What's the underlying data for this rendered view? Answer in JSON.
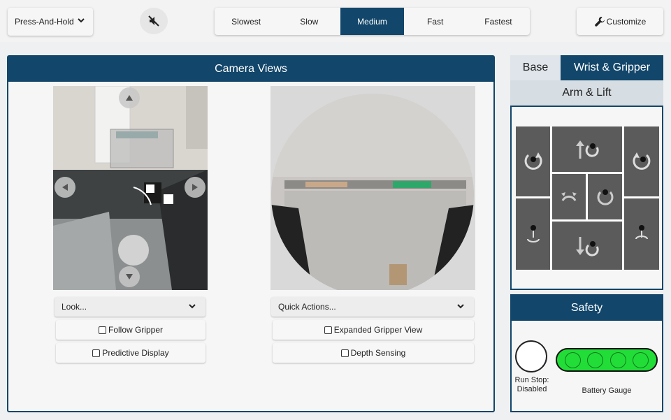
{
  "topbar": {
    "mode_select": "Press-And-Hold",
    "mute_icon": "speaker-muted-icon",
    "speeds": [
      "Slowest",
      "Slow",
      "Medium",
      "Fast",
      "Fastest"
    ],
    "active_speed": "Medium",
    "customize_label": "Customize",
    "customize_icon": "wrench-icon"
  },
  "camera_panel": {
    "title": "Camera Views",
    "left": {
      "dropdown": "Look...",
      "checks": [
        "Follow Gripper",
        "Predictive Display"
      ]
    },
    "right": {
      "dropdown": "Quick Actions...",
      "checks": [
        "Expanded Gripper View",
        "Depth Sensing"
      ]
    }
  },
  "controls": {
    "tabs": [
      "Base",
      "Wrist & Gripper"
    ],
    "active_tab": "Wrist & Gripper",
    "subtab": "Arm & Lift"
  },
  "safety": {
    "title": "Safety",
    "runstop_label": "Run Stop: Disabled",
    "battery_label": "Battery Gauge",
    "battery_color": "#22dd37"
  },
  "colors": {
    "accent": "#12466a"
  }
}
